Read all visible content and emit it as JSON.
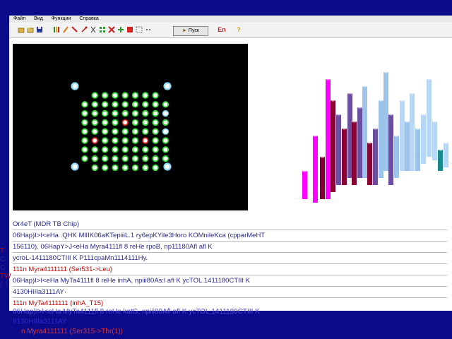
{
  "menu": [
    "Файл",
    "Вид",
    "Функции",
    "Справка"
  ],
  "toolbar": {
    "go_label": "Пуск",
    "lang_label": "En",
    "help_label": "?"
  },
  "text_panel": {
    "title": "Or4eT  (MDR TB Chip)",
    "lines": [
      {
        "text": "06Hap)I>I<eHa .QHK MlIIK06aKTepiiiL.1 ry6epKYile3Horo KOMnileKca (cpparMeHT",
        "cls": ""
      },
      {
        "text": "156110). 06HapY>J<eHa  Myra4111fl 8 reHe rpoB, np11180Afl afl K",
        "cls": ""
      },
      {
        "text": "ycroL-1411180CTIII  K P111cpaMn1114111Hy.",
        "cls": ""
      },
      {
        "text": "  111n Myra4111111 (Ser531->Leu)",
        "cls": "red"
      },
      {
        "text": "06Hap)I>I<eHa  MyTa4111fl 8 reHe inhA, npiii80As:l afl K ycTOL.1411180CTIII  K",
        "cls": ""
      },
      {
        "text": "4130HIIIa3111AY·",
        "cls": ""
      },
      {
        "text": "  111n MyTa4111111 (inhA_T15)",
        "cls": "red"
      }
    ]
  },
  "overflow_lines": [
    {
      "text": "06Hap)I>I<eHa  MyTa4111fl 8 reHe katG, npiii80Afl afl K ycTOL.1411180CTIII  K",
      "cls": ""
    },
    {
      "text": "II130HIIIa3111AY",
      "cls": ""
    },
    {
      "text": "  n Myra4111111 (Ser315->Thr(1))",
      "cls": "red"
    }
  ],
  "margin_chars": [
    "T",
    "C",
    "C",
    "TW",
    "/. \\"
  ],
  "chip": {
    "highlight_color": "#8bd9f5",
    "ring_color": "#2fd42f",
    "mutation_color": "#dd2222"
  },
  "chart3d": {
    "colors": [
      "#ff00ff",
      "#8a0033",
      "#6a4fa0",
      "#9cc4ea",
      "#b8d6f5",
      "#1a8a8a",
      "#ffffff"
    ]
  }
}
